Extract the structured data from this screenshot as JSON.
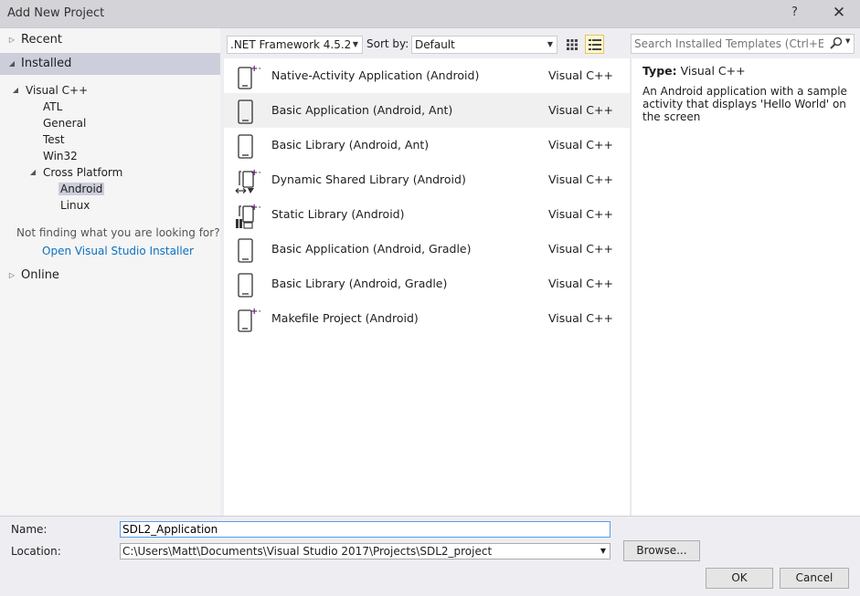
{
  "window": {
    "title": "Add New Project",
    "help": "?",
    "close": "✕"
  },
  "tree": {
    "recent": "Recent",
    "installed": "Installed",
    "visual_cpp": "Visual C++",
    "children": [
      "ATL",
      "General",
      "Test",
      "Win32"
    ],
    "cross_platform": "Cross Platform",
    "android": "Android",
    "linux": "Linux",
    "not_finding": "Not finding what you are looking for?",
    "installer_link": "Open Visual Studio Installer",
    "online": "Online"
  },
  "toolbar": {
    "framework": ".NET Framework 4.5.2",
    "sort_label": "Sort by:",
    "sort_value": "Default",
    "search_placeholder": "Search Installed Templates (Ctrl+E)"
  },
  "templates": [
    {
      "name": "Native-Activity Application (Android)",
      "lang": "Visual C++",
      "icon": "android-plus-icon"
    },
    {
      "name": "Basic Application (Android, Ant)",
      "lang": "Visual C++",
      "icon": "phone-icon"
    },
    {
      "name": "Basic Library (Android, Ant)",
      "lang": "Visual C++",
      "icon": "phone-icon"
    },
    {
      "name": "Dynamic Shared Library (Android)",
      "lang": "Visual C++",
      "icon": "dynamic-library-icon"
    },
    {
      "name": "Static Library (Android)",
      "lang": "Visual C++",
      "icon": "static-library-icon"
    },
    {
      "name": "Basic Application (Android, Gradle)",
      "lang": "Visual C++",
      "icon": "phone-icon"
    },
    {
      "name": "Basic Library (Android, Gradle)",
      "lang": "Visual C++",
      "icon": "phone-icon"
    },
    {
      "name": "Makefile Project (Android)",
      "lang": "Visual C++",
      "icon": "android-plus-icon"
    }
  ],
  "selected_index": 1,
  "details": {
    "type_label": "Type:",
    "type_value": "Visual C++",
    "description": "An Android application with a sample activity that displays 'Hello World' on the screen"
  },
  "form": {
    "name_label": "Name:",
    "name_value": "SDL2_Application",
    "location_label": "Location:",
    "location_value": "C:\\Users\\Matt\\Documents\\Visual Studio 2017\\Projects\\SDL2_project",
    "browse": "Browse...",
    "ok": "OK",
    "cancel": "Cancel"
  },
  "colors": {
    "accent_link": "#0e70c0",
    "selection": "#cccedb",
    "plus_purple": "#68217a"
  }
}
